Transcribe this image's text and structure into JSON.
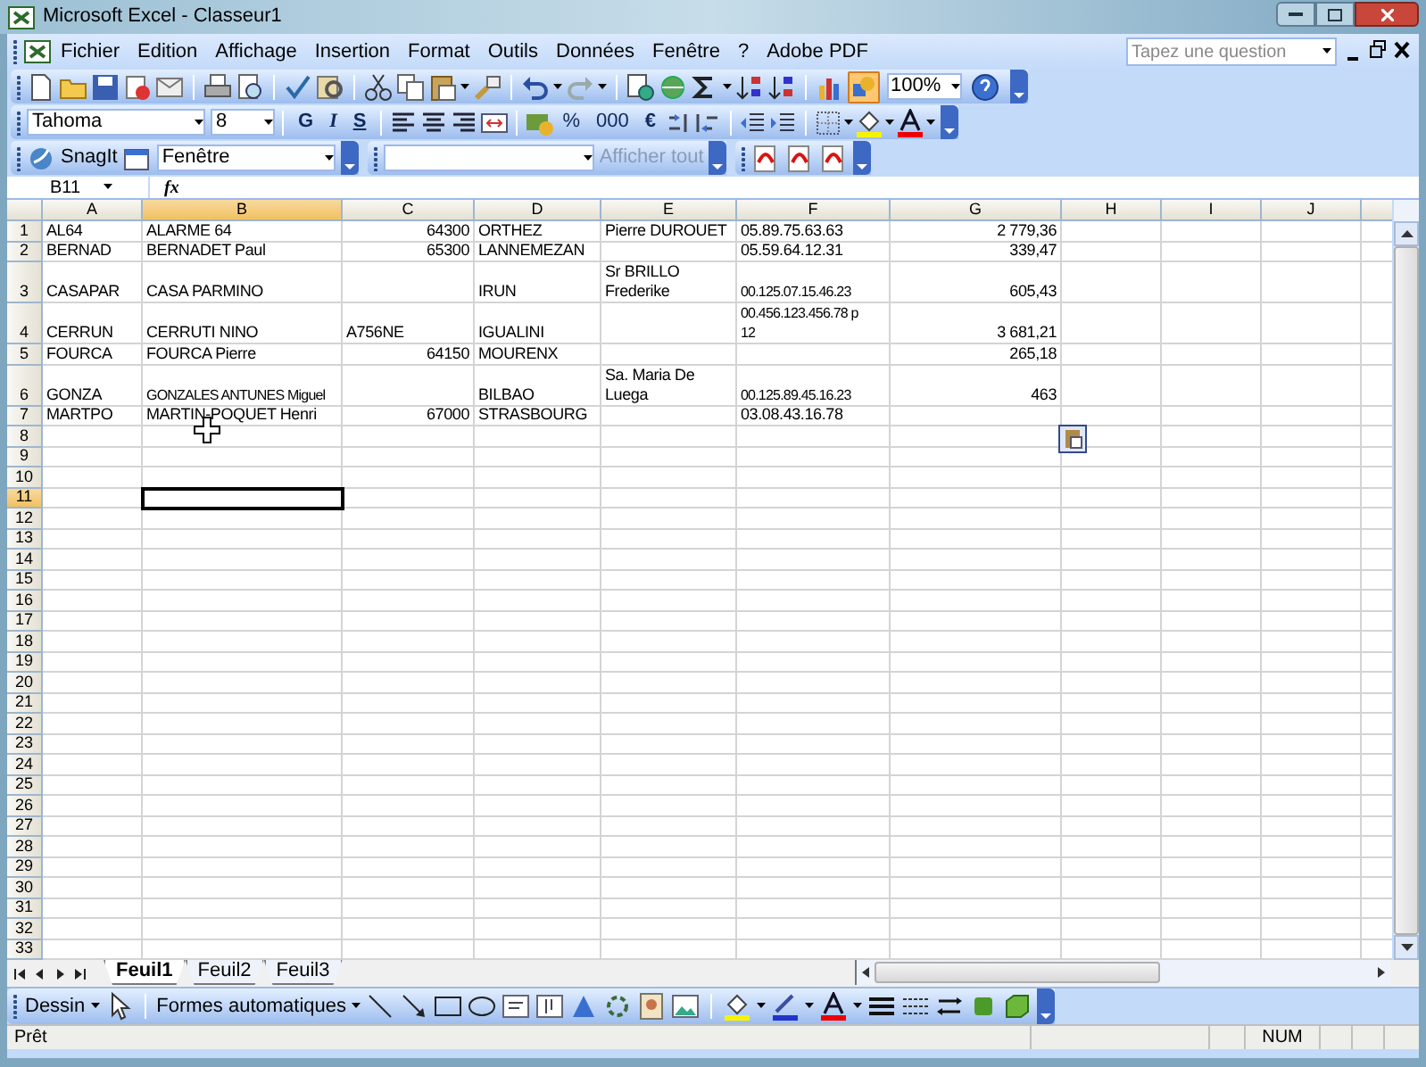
{
  "window": {
    "title": "Microsoft Excel - Classeur1"
  },
  "menu_bar": {
    "items": [
      {
        "label": "Fichier"
      },
      {
        "label": "Edition"
      },
      {
        "label": "Affichage"
      },
      {
        "label": "Insertion"
      },
      {
        "label": "Format"
      },
      {
        "label": "Outils"
      },
      {
        "label": "Données"
      },
      {
        "label": "Fenêtre"
      },
      {
        "label": "?"
      },
      {
        "label": "Adobe PDF"
      }
    ],
    "help_box": {
      "placeholder": "Tapez une question"
    }
  },
  "standard_toolbar": {
    "zoom": "100%",
    "drawing_pressed": true
  },
  "format_toolbar": {
    "font": "Tahoma",
    "size": "8",
    "bold": "G",
    "italic": "I",
    "underline": "S",
    "percent": "%",
    "thousands": "000",
    "euro": "€"
  },
  "snagit_toolbar": {
    "label": "SnagIt",
    "window_select": "Fenêtre",
    "show_all": {
      "label": "Afficher tout",
      "disabled": true
    }
  },
  "formula_bar": {
    "name_box": "B11",
    "fx": "fx"
  },
  "sheet": {
    "columns": [
      {
        "label": "A",
        "selected": false
      },
      {
        "label": "B",
        "selected": true
      },
      {
        "label": "C",
        "selected": false
      },
      {
        "label": "D",
        "selected": false
      },
      {
        "label": "E",
        "selected": false
      },
      {
        "label": "F",
        "selected": false
      },
      {
        "label": "G",
        "selected": false
      },
      {
        "label": "H",
        "selected": false
      },
      {
        "label": "I",
        "selected": false
      },
      {
        "label": "J",
        "selected": false
      }
    ],
    "rows": [
      {
        "number": "1",
        "selected": false,
        "cells": [
          {
            "text": "AL64",
            "kind": "text"
          },
          {
            "text": "ALARME 64",
            "kind": "text"
          },
          {
            "text": "64300",
            "kind": "number"
          },
          {
            "text": "ORTHEZ",
            "kind": "text"
          },
          {
            "text": "Pierre DUROUET",
            "kind": "text"
          },
          {
            "text": "05.89.75.63.63",
            "kind": "text"
          },
          {
            "text": "2 779,36",
            "kind": "number"
          }
        ]
      },
      {
        "number": "2",
        "selected": false,
        "cells": [
          {
            "text": "BERNAD",
            "kind": "text"
          },
          {
            "text": "BERNADET Paul",
            "kind": "text"
          },
          {
            "text": "65300",
            "kind": "number"
          },
          {
            "text": "LANNEMEZAN",
            "kind": "text"
          },
          null,
          {
            "text": "05.59.64.12.31",
            "kind": "text"
          },
          {
            "text": "339,47",
            "kind": "number"
          }
        ]
      },
      {
        "number": "3",
        "selected": false,
        "cells": [
          {
            "text": "CASAPAR",
            "kind": "text"
          },
          {
            "text": "CASA PARMINO",
            "kind": "text"
          },
          null,
          {
            "text": "IRUN",
            "kind": "text"
          },
          {
            "text": "Sr BRILLO\nFrederike",
            "kind": "text"
          },
          {
            "text": "00.125.07.15.46.23",
            "kind": "text"
          },
          {
            "text": "605,43",
            "kind": "number"
          }
        ]
      },
      {
        "number": "4",
        "selected": false,
        "cells": [
          {
            "text": "CERRUN",
            "kind": "text"
          },
          {
            "text": "CERRUTI NINO",
            "kind": "text"
          },
          {
            "text": "A756NE",
            "kind": "text"
          },
          {
            "text": "IGUALINI",
            "kind": "text"
          },
          null,
          {
            "text": "00.456.123.456.78 p\n12",
            "kind": "text"
          },
          {
            "text": "3 681,21",
            "kind": "number"
          }
        ]
      },
      {
        "number": "5",
        "selected": false,
        "cells": [
          {
            "text": "FOURCA",
            "kind": "text"
          },
          {
            "text": "FOURCA Pierre",
            "kind": "text"
          },
          {
            "text": "64150",
            "kind": "number"
          },
          {
            "text": "MOURENX",
            "kind": "text"
          },
          null,
          null,
          {
            "text": "265,18",
            "kind": "number"
          }
        ]
      },
      {
        "number": "6",
        "selected": false,
        "cells": [
          {
            "text": "GONZA",
            "kind": "text"
          },
          {
            "text": "GONZALES ANTUNES Miguel",
            "kind": "text"
          },
          null,
          {
            "text": "BILBAO",
            "kind": "text"
          },
          {
            "text": "Sa. Maria De\nLuega",
            "kind": "text"
          },
          {
            "text": "00.125.89.45.16.23",
            "kind": "text"
          },
          {
            "text": "463",
            "kind": "number"
          }
        ]
      },
      {
        "number": "7",
        "selected": false,
        "cells": [
          {
            "text": "MARTPO",
            "kind": "text"
          },
          {
            "text": "MARTIN-POQUET Henri",
            "kind": "text"
          },
          {
            "text": "67000",
            "kind": "number"
          },
          {
            "text": "STRASBOURG",
            "kind": "text"
          },
          null,
          {
            "text": "03.08.43.16.78",
            "kind": "text"
          },
          null
        ]
      },
      {
        "number": "8",
        "selected": false
      },
      {
        "number": "9",
        "selected": false
      },
      {
        "number": "10",
        "selected": false
      },
      {
        "number": "11",
        "selected": true
      },
      {
        "number": "12",
        "selected": false
      },
      {
        "number": "13",
        "selected": false
      },
      {
        "number": "14",
        "selected": false
      },
      {
        "number": "15",
        "selected": false
      },
      {
        "number": "16",
        "selected": false
      },
      {
        "number": "17",
        "selected": false
      },
      {
        "number": "18",
        "selected": false
      },
      {
        "number": "19",
        "selected": false
      },
      {
        "number": "20",
        "selected": false
      },
      {
        "number": "21",
        "selected": false
      },
      {
        "number": "22",
        "selected": false
      },
      {
        "number": "23",
        "selected": false
      },
      {
        "number": "24",
        "selected": false
      },
      {
        "number": "25",
        "selected": false
      },
      {
        "number": "26",
        "selected": false
      },
      {
        "number": "27",
        "selected": false
      },
      {
        "number": "28",
        "selected": false
      },
      {
        "number": "29",
        "selected": false
      },
      {
        "number": "30",
        "selected": false
      },
      {
        "number": "31",
        "selected": false
      },
      {
        "number": "32",
        "selected": false
      },
      {
        "number": "33",
        "selected": false
      }
    ]
  },
  "sheet_tabs": [
    {
      "label": "Feuil1",
      "selected": true
    },
    {
      "label": "Feuil2",
      "selected": false
    },
    {
      "label": "Feuil3",
      "selected": false
    }
  ],
  "drawing_toolbar": {
    "menu": "Dessin",
    "autoshapes": "Formes automatiques"
  },
  "status_bar": {
    "status": "Prêt",
    "num_lock": "NUM"
  }
}
